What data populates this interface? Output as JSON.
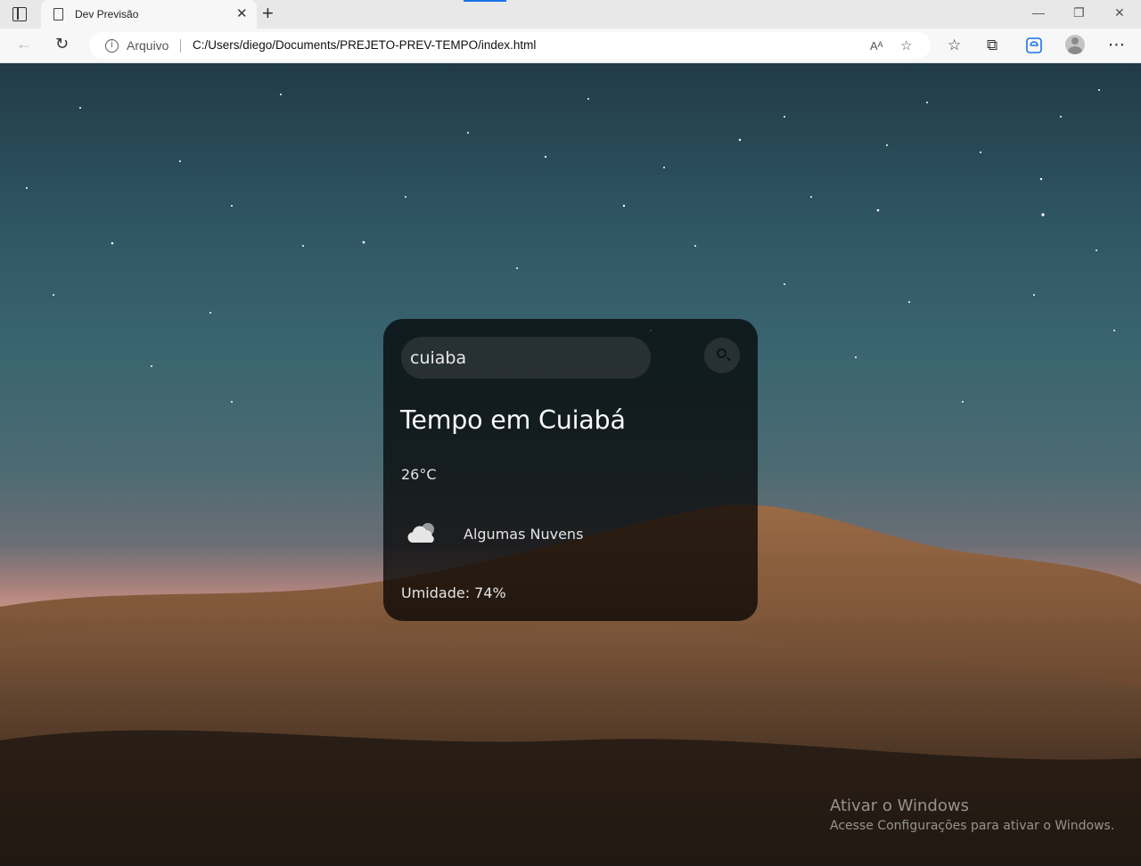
{
  "browser": {
    "tab": {
      "title": "Dev Previsão"
    },
    "window_controls": [
      "minimize",
      "restore",
      "close"
    ],
    "address_bar": {
      "origin_label": "Arquivo",
      "url": "C:/Users/diego/Documents/PREJETO-PREV-TEMPO/index.html"
    },
    "icons": {
      "read_aloud": "Aᴬ",
      "favorite_add": "☆",
      "favorites": "☆",
      "collections": "⧉",
      "more": "⋯"
    }
  },
  "weather_card": {
    "search": {
      "value": "cuiaba"
    },
    "title": "Tempo em Cuiabá",
    "temperature": "26°C",
    "condition": "Algumas Nuvens",
    "humidity": "Umidade: 74%"
  },
  "watermark": {
    "title": "Ativar o Windows",
    "subtitle": "Acesse Configurações para ativar o Windows."
  }
}
